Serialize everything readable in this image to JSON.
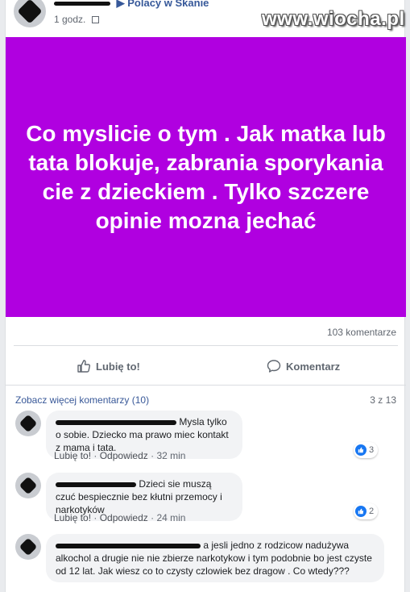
{
  "header": {
    "group_name": "Polacy w Skanie",
    "time": "1 godz.",
    "watermark": "www.wiocha.pl"
  },
  "post": {
    "text": "Co myslicie o tym . Jak matka lub tata blokuje, zabrania sporykania cie z dzieckiem . Tylko szczere opinie mozna jechać",
    "background_color": "#b000e0",
    "comments_count": "103 komentarze"
  },
  "actions": {
    "like_label": "Lubię to!",
    "comment_label": "Komentarz"
  },
  "comments_section": {
    "more_label": "Zobacz więcej komentarzy (10)",
    "pager": "3 z 13"
  },
  "comments": [
    {
      "text": "Mysla tylko o sobie. Dziecko ma prawo miec kontakt z mama i tata.",
      "like_label": "Lubię to!",
      "reply_label": "Odpowiedz",
      "time": "32 min",
      "reactions": "3"
    },
    {
      "text": "Dzieci sie muszą czuć bespiecznie bez kłutni przemocy i narkotyków",
      "like_label": "Lubię to!",
      "reply_label": "Odpowiedz",
      "time": "24 min",
      "reactions": "2"
    },
    {
      "text": "a jesli jedno z rodzicow nadużywa alkochol a drugie nie nie zbierze narkotykow i tym podobnie bo jest czyste od 12 lat. Jak wiesz co to czysty czlowiek bez dragow . Co wtedy???"
    }
  ],
  "colors": {
    "link": "#385898",
    "like_blue": "#1877f2"
  }
}
